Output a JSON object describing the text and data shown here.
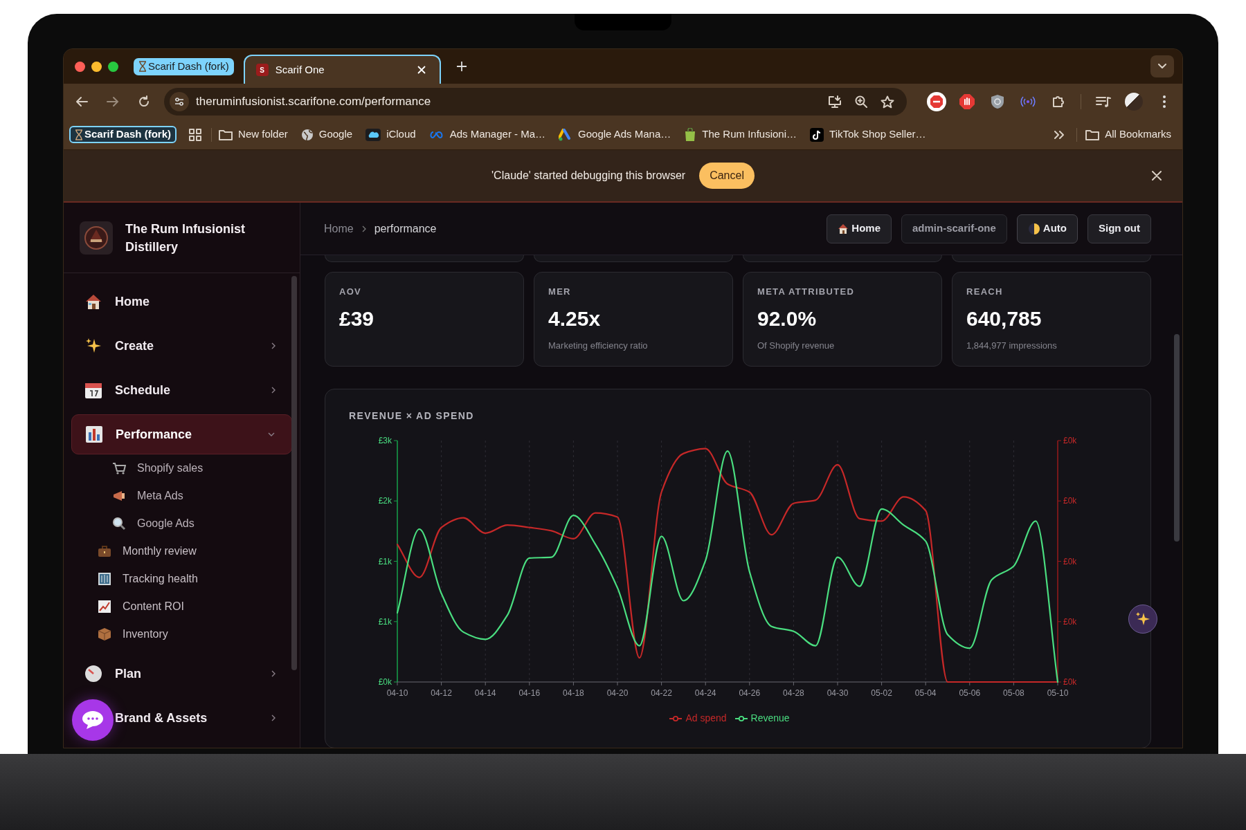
{
  "browser": {
    "tab_group": "Scarif Dash (fork)",
    "tabs": [
      {
        "title": "Scarif One",
        "favicon": "S",
        "selected": true
      }
    ],
    "url": "theruminfusionist.scarifone.com/performance",
    "bookmarks": [
      {
        "label": "Scarif Dash (fork)",
        "kind": "group"
      },
      {
        "label": "New folder",
        "kind": "folder"
      },
      {
        "label": "Google",
        "kind": "site"
      },
      {
        "label": "iCloud",
        "kind": "site"
      },
      {
        "label": "Ads Manager - Ma…",
        "kind": "site"
      },
      {
        "label": "Google Ads Mana…",
        "kind": "site"
      },
      {
        "label": "The Rum Infusioni…",
        "kind": "site"
      },
      {
        "label": "TikTok Shop Seller…",
        "kind": "site"
      }
    ],
    "all_bookmarks": "All Bookmarks"
  },
  "banner": {
    "message": "'Claude' started debugging this browser",
    "button": "Cancel"
  },
  "app": {
    "brand": "The Rum Infusionist Distillery",
    "sidebar": {
      "items": [
        {
          "label": "Home",
          "selected": false
        },
        {
          "label": "Create",
          "selected": false,
          "expanded": false
        },
        {
          "label": "Schedule",
          "selected": false,
          "expanded": false
        },
        {
          "label": "Performance",
          "selected": true,
          "expanded": true,
          "children": [
            {
              "label": "Shopify sales",
              "kind": "channel",
              "selected": false
            },
            {
              "label": "Meta Ads",
              "kind": "channel",
              "selected": false
            },
            {
              "label": "Google Ads",
              "kind": "channel",
              "selected": false
            },
            {
              "label": "Monthly review",
              "kind": "page",
              "selected": false
            },
            {
              "label": "Tracking health",
              "kind": "page",
              "selected": false
            },
            {
              "label": "Content ROI",
              "kind": "page",
              "selected": false
            },
            {
              "label": "Inventory",
              "kind": "page",
              "selected": false
            }
          ]
        },
        {
          "label": "Plan",
          "selected": false,
          "expanded": false
        },
        {
          "label": "Brand & Assets",
          "selected": false,
          "expanded": false
        }
      ]
    },
    "breadcrumbs": [
      "Home",
      "performance"
    ],
    "header_buttons": [
      {
        "label": "Home",
        "kind": "home"
      },
      {
        "label": "admin-scarif-one",
        "kind": "user"
      },
      {
        "label": "Auto",
        "kind": "theme"
      },
      {
        "label": "Sign out",
        "kind": "plain"
      }
    ],
    "stats": [
      {
        "label": "AOV",
        "value": "£39"
      },
      {
        "label": "MER",
        "value": "4.25x",
        "note": "Marketing efficiency ratio"
      },
      {
        "label": "META ATTRIBUTED",
        "value": "92.0%",
        "note": "Of Shopify revenue"
      },
      {
        "label": "REACH",
        "value": "640,785",
        "note": "1,844,977 impressions"
      }
    ],
    "chart": {
      "title": "REVENUE × AD SPEND",
      "right_axis_ticks": [
        "£0k",
        "£0k",
        "£0k",
        "£0k",
        "£0k"
      ],
      "chart_data": {
        "type": "line",
        "categories": [
          "04-10",
          null,
          "04-12",
          null,
          "04-14",
          null,
          "04-16",
          null,
          "04-18",
          null,
          "04-20",
          null,
          "04-22",
          null,
          "04-24",
          null,
          "04-26",
          null,
          "04-28",
          null,
          "04-30",
          null,
          "05-02",
          null,
          "05-04",
          null,
          "05-06",
          null,
          "05-08",
          null,
          "05-10"
        ],
        "ylim": [
          0,
          3
        ],
        "grid": true,
        "yticks": [
          {
            "value": 0,
            "label": "£0k"
          },
          {
            "value": 0.75,
            "label": "£1k"
          },
          {
            "value": 1.5,
            "label": "£1k"
          },
          {
            "value": 2.25,
            "label": "£2k"
          },
          {
            "value": 3,
            "label": "£3k"
          }
        ],
        "series": [
          {
            "name": "Ad spend",
            "color": "#c62828",
            "values": [
              1.71,
              1.3,
              1.92,
              2.04,
              1.85,
              1.95,
              1.92,
              1.88,
              1.78,
              2.1,
              2.05,
              0.3,
              2.36,
              2.84,
              2.9,
              2.46,
              2.36,
              1.83,
              2.22,
              2.26,
              2.7,
              2.03,
              2.0,
              2.3,
              2.13,
              0,
              0,
              0,
              0,
              0,
              0
            ]
          },
          {
            "name": "Revenue",
            "color": "#4ade80",
            "values": [
              0.86,
              1.9,
              1.1,
              0.62,
              0.53,
              0.83,
              1.54,
              1.55,
              2.07,
              1.71,
              1.17,
              0.45,
              1.81,
              1.01,
              1.51,
              2.87,
              1.37,
              0.69,
              0.63,
              0.45,
              1.55,
              1.19,
              2.15,
              1.95,
              1.75,
              0.59,
              0.42,
              1.27,
              1.44,
              2.0,
              0
            ]
          }
        ]
      }
    }
  }
}
